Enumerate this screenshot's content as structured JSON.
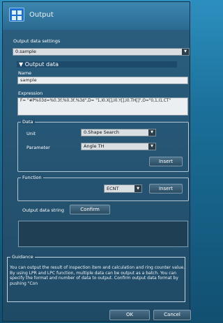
{
  "window": {
    "title": "Output"
  },
  "output_settings": {
    "label": "Output data settings",
    "selected": "0.sample"
  },
  "output_data": {
    "header": "▼ Output data",
    "name_label": "Name",
    "name_value": "sample",
    "expression_label": "Expression",
    "expression_value": "F= \"#P%03d=%0.3f,%0.3f,%3d\",D= \"1,I0.X[],I0.Y[],I0.TH[]\",O=\"0,1,I1.CT\""
  },
  "data_group": {
    "title": "Data",
    "unit_label": "Unit",
    "unit_value": "0.Shape Search",
    "parameter_label": "Parameter",
    "parameter_value": "Angle TH",
    "insert_label": "Insert"
  },
  "function_group": {
    "title": "Function",
    "function_value": "ECNT",
    "insert_label": "Insert"
  },
  "output_string": {
    "label": "Output data string",
    "confirm_label": "Confirm"
  },
  "guidance": {
    "title": "Guidance",
    "text": "You can output the result of inspection item and calculation and ring counter value. By using LPR and LPC function, multiple data can be output as a batch. You can specify the format and number of data to output. Confirm output data format by pushing \"Con"
  },
  "footer": {
    "ok_label": "OK",
    "cancel_label": "Cancel"
  },
  "icons": {
    "window_icon": "output-window-icon",
    "dropdown": "chevron-down-icon"
  }
}
